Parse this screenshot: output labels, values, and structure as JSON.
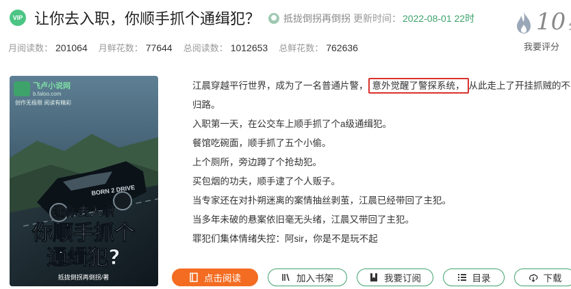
{
  "header": {
    "vip_badge": "VIP",
    "title": "让你去入职，你顺手抓个通缉犯？",
    "author": "抵拢倒拐再倒拐",
    "update_label": "更新时间：",
    "update_time": "2022-08-01 22时"
  },
  "rating": {
    "score": "10",
    "unit": "分",
    "rate_link": "我要评分",
    "icon": "flame-icon"
  },
  "stats": [
    {
      "label": "月阅读数：",
      "value": "201064"
    },
    {
      "label": "月鲜花数：",
      "value": "77644"
    },
    {
      "label": "总阅读数：",
      "value": "1012653"
    },
    {
      "label": "总鲜花数：",
      "value": "762636"
    }
  ],
  "cover": {
    "site_name": "飞卢小说网",
    "site_url": "b.faloo.com",
    "slogan": "创作无极限  阅读有精彩",
    "cover_title_1": "让你去入职",
    "cover_title_2": "你顺手抓个",
    "cover_title_3": "通缉犯?",
    "cover_author": "抵拢倒拐再倒拐/著",
    "car_text": "BORN 2 DRIVE"
  },
  "description": {
    "line1_before": "江晨穿越平行世界，成为了一名普通片警，",
    "line1_highlight": "意外觉醒了警探系统，",
    "line1_after": "从此走上了开挂抓贼的不归路。",
    "lines": [
      "入职第一天，在公交车上顺手抓了个a级通缉犯。",
      "餐馆吃碗面，顺手抓了五个小偷。",
      "上个厕所，旁边蹲了个抢劫犯。",
      "买包烟的功夫，顺手逮了个人贩子。",
      "当专家还在对扑朔迷离的案情抽丝剥茧，江晨已经带回了主犯。",
      "当多年未破的悬案依旧毫无头绪，江晨又带回了主犯。",
      "罪犯们集体情绪失控：阿sir，你是不是玩不起"
    ]
  },
  "buttons": {
    "read": "点击阅读",
    "shelf": "加入书架",
    "subscribe": "我要订阅",
    "catalog": "目录",
    "download": "下载"
  },
  "colors": {
    "accent_green": "#3ea36b",
    "primary_orange": "#f36c21",
    "highlight_red": "#d9302a"
  }
}
